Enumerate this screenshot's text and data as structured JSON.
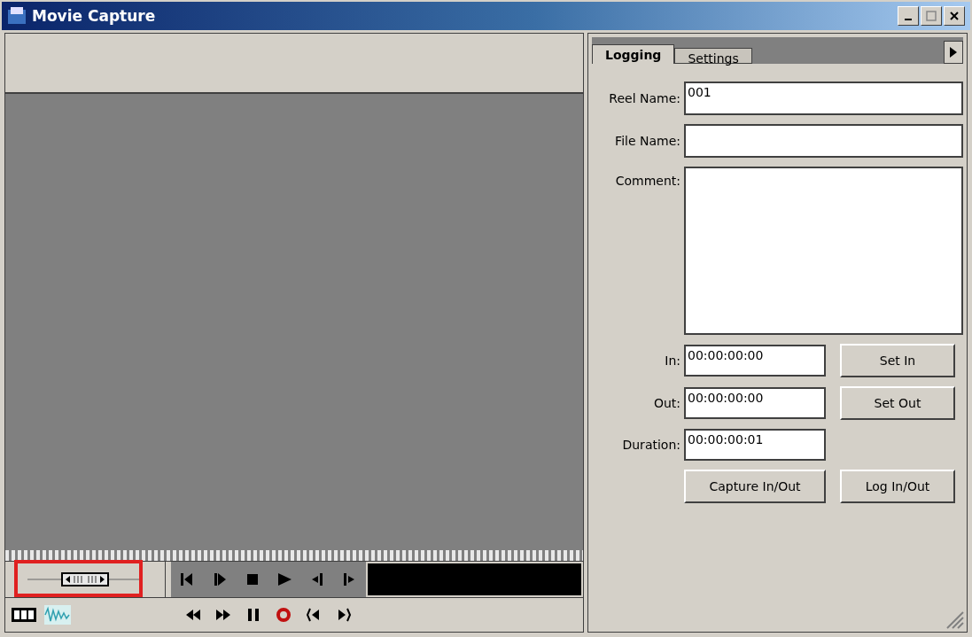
{
  "window": {
    "title": "Movie Capture"
  },
  "tabs": [
    {
      "label": "Logging",
      "selected": true
    },
    {
      "label": "Settings",
      "selected": false
    }
  ],
  "fields": [
    {
      "label": "Reel Name:",
      "value": "001",
      "kind": "text"
    },
    {
      "label": "File Name:",
      "kind": "text"
    },
    {
      "label": "Comment:",
      "kind": "area"
    }
  ],
  "timecodes": [
    {
      "label": "In:",
      "value": "00:00:00:00",
      "button": "Set In"
    },
    {
      "label": "Out:",
      "value": "00:00:00:00",
      "button": "Set Out"
    },
    {
      "label": "Duration:",
      "value": "00:00:00:01"
    }
  ],
  "actions": [
    "Capture In/Out",
    "Log In/Out"
  ],
  "jog": {
    "level": 0.5
  },
  "transport_top": [
    {
      "kind": "step-back"
    },
    {
      "kind": "step-forward"
    },
    {
      "kind": "stop"
    },
    {
      "kind": "play"
    },
    {
      "kind": "go-to-in"
    },
    {
      "kind": "go-to-out"
    }
  ],
  "transport_bottom": [
    {
      "kind": "rewind"
    },
    {
      "kind": "fast-forward"
    },
    {
      "kind": "pause"
    },
    {
      "kind": "record"
    },
    {
      "kind": "previous-edit"
    },
    {
      "kind": "next-edit"
    }
  ]
}
